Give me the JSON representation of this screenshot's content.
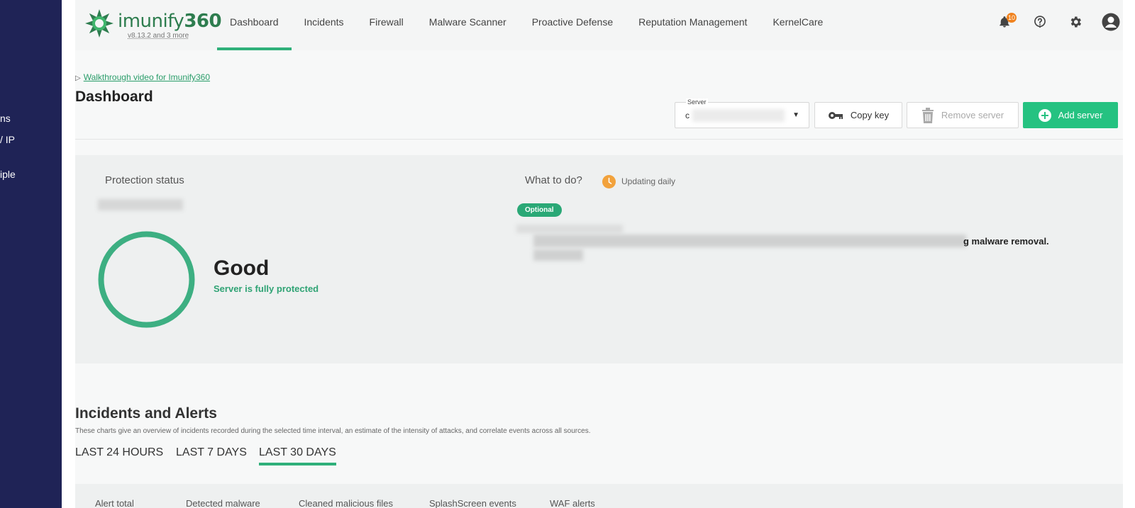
{
  "sidebar": {
    "items": [
      {
        "label": "ns"
      },
      {
        "label": "/ IP"
      },
      {
        "label": "iple"
      }
    ]
  },
  "header": {
    "logo_text": "imunify",
    "logo_number": "360",
    "version": "v8.13.2 and 3 more",
    "nav": [
      {
        "label": "Dashboard",
        "active": true
      },
      {
        "label": "Incidents"
      },
      {
        "label": "Firewall"
      },
      {
        "label": "Malware Scanner"
      },
      {
        "label": "Proactive Defense"
      },
      {
        "label": "Reputation Management"
      },
      {
        "label": "KernelCare"
      }
    ],
    "icons": {
      "notifications": "bell-icon",
      "notification_count": "10",
      "help": "help-icon",
      "settings": "gear-icon",
      "account": "user-avatar-icon"
    }
  },
  "page": {
    "walkthrough_link": "Walkthrough video for Imunify360",
    "title": "Dashboard",
    "server": {
      "label": "Server",
      "value": "c"
    },
    "buttons": {
      "copy_key": "Copy key",
      "remove_server": "Remove server",
      "add_server": "Add server"
    }
  },
  "protection": {
    "title": "Protection status",
    "status": "Good",
    "subtitle": "Server is fully protected",
    "color": "#3daf82"
  },
  "what_to_do": {
    "title": "What to do?",
    "updating": "Updating daily",
    "optional_label": "Optional",
    "recommendation_visible": "g malware removal."
  },
  "incidents": {
    "title": "Incidents and Alerts",
    "description": "These charts give an overview of incidents recorded during the selected time interval, an estimate of the intensity of attacks, and correlate events across all sources.",
    "tabs": [
      {
        "label": "LAST 24 HOURS"
      },
      {
        "label": "LAST 7 DAYS"
      },
      {
        "label": "LAST 30 DAYS",
        "active": true
      }
    ],
    "stats": [
      {
        "label": "Alert total"
      },
      {
        "label": "Detected malware"
      },
      {
        "label": "Cleaned malicious files"
      },
      {
        "label": "SplashScreen events"
      },
      {
        "label": "WAF alerts"
      }
    ]
  },
  "colors": {
    "sidebar": "#1f2356",
    "accent": "#2fb07a",
    "add_button": "#25c281",
    "badge": "#f0821e"
  }
}
